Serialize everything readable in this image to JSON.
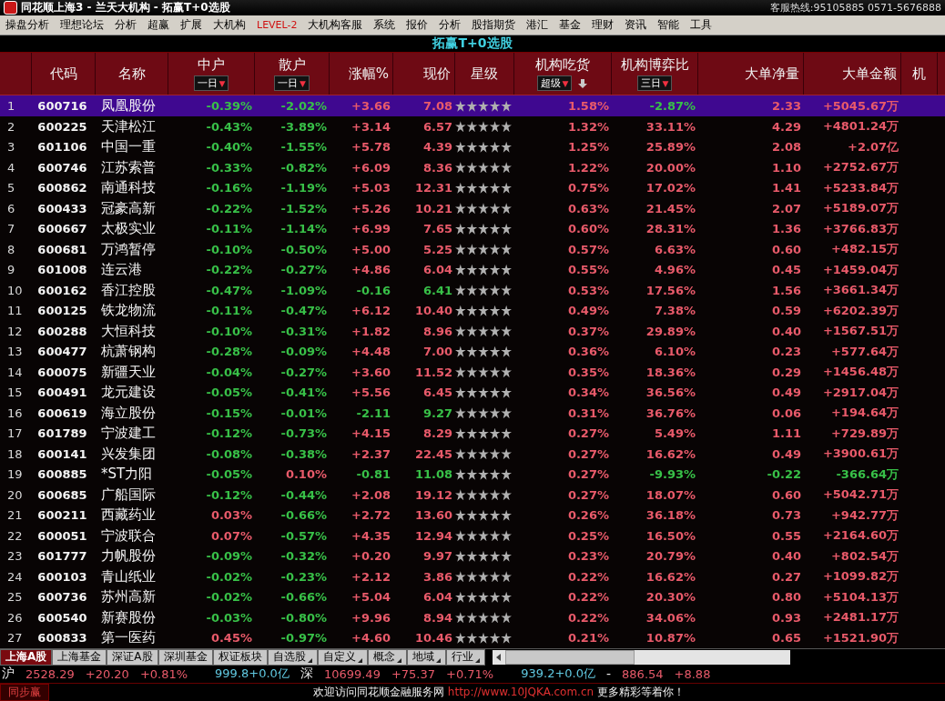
{
  "window": {
    "title": "同花顺上海3 - 兰天大机构 - 拓赢T+0选股",
    "hotline": "客服热线:95105885 0571-5676888"
  },
  "menu": [
    {
      "label": "操盘分析",
      "highlighted": false
    },
    {
      "label": "理想论坛",
      "highlighted": false
    },
    {
      "label": "分析",
      "highlighted": false
    },
    {
      "label": "超赢",
      "highlighted": false
    },
    {
      "label": "扩展",
      "highlighted": false
    },
    {
      "label": "大机构",
      "highlighted": false
    },
    {
      "label": "LEVEL-2",
      "highlighted": true
    },
    {
      "label": "大机构客服",
      "highlighted": false
    },
    {
      "label": "系统",
      "highlighted": false
    },
    {
      "label": "报价",
      "highlighted": false
    },
    {
      "label": "分析",
      "highlighted": false
    },
    {
      "label": "股指期货",
      "highlighted": false
    },
    {
      "label": "港汇",
      "highlighted": false
    },
    {
      "label": "基金",
      "highlighted": false
    },
    {
      "label": "理财",
      "highlighted": false
    },
    {
      "label": "资讯",
      "highlighted": false
    },
    {
      "label": "智能",
      "highlighted": false
    },
    {
      "label": "工具",
      "highlighted": false
    }
  ],
  "table": {
    "caption": "拓赢T+0选股",
    "columns": [
      {
        "label": "代码"
      },
      {
        "label": "名称"
      },
      {
        "label": "中户",
        "dropdown": "一日",
        "arrow": "▼"
      },
      {
        "label": "散户",
        "dropdown": "一日",
        "arrow": "▼"
      },
      {
        "label": "涨幅%"
      },
      {
        "label": "现价"
      },
      {
        "label": "星级"
      },
      {
        "label": "机构吃货",
        "dropdown": "超级",
        "arrow": "▼",
        "sort": true
      },
      {
        "label": "机构博弈比",
        "dropdown": "三日",
        "arrow": "▼"
      },
      {
        "label": "大单净量"
      },
      {
        "label": "大单金额"
      },
      {
        "label": "机"
      }
    ],
    "rows": [
      {
        "n": "1",
        "code": "600716",
        "name": "凤凰股份",
        "mid": "-0.39%",
        "retail": "-2.02%",
        "chg": "+3.66",
        "price": "7.08",
        "stars": 5,
        "inst": "1.58%",
        "ratio": "-2.87%",
        "net": "2.33",
        "amount": "+5045.67万",
        "selected": true
      },
      {
        "n": "2",
        "code": "600225",
        "name": "天津松江",
        "mid": "-0.43%",
        "retail": "-3.89%",
        "chg": "+3.14",
        "price": "6.57",
        "stars": 5,
        "inst": "1.32%",
        "ratio": "33.11%",
        "net": "4.29",
        "amount": "+4801.24万",
        "selected": false
      },
      {
        "n": "3",
        "code": "601106",
        "name": "中国一重",
        "mid": "-0.40%",
        "retail": "-1.55%",
        "chg": "+5.78",
        "price": "4.39",
        "stars": 5,
        "inst": "1.25%",
        "ratio": "25.89%",
        "net": "2.08",
        "amount": "+2.07亿",
        "selected": false
      },
      {
        "n": "4",
        "code": "600746",
        "name": "江苏索普",
        "mid": "-0.33%",
        "retail": "-0.82%",
        "chg": "+6.09",
        "price": "8.36",
        "stars": 5,
        "inst": "1.22%",
        "ratio": "20.00%",
        "net": "1.10",
        "amount": "+2752.67万",
        "selected": false
      },
      {
        "n": "5",
        "code": "600862",
        "name": "南通科技",
        "mid": "-0.16%",
        "retail": "-1.19%",
        "chg": "+5.03",
        "price": "12.31",
        "stars": 5,
        "inst": "0.75%",
        "ratio": "17.02%",
        "net": "1.41",
        "amount": "+5233.84万",
        "selected": false
      },
      {
        "n": "6",
        "code": "600433",
        "name": "冠豪高新",
        "mid": "-0.22%",
        "retail": "-1.52%",
        "chg": "+5.26",
        "price": "10.21",
        "stars": 5,
        "inst": "0.63%",
        "ratio": "21.45%",
        "net": "2.07",
        "amount": "+5189.07万",
        "selected": false
      },
      {
        "n": "7",
        "code": "600667",
        "name": "太极实业",
        "mid": "-0.11%",
        "retail": "-1.14%",
        "chg": "+6.99",
        "price": "7.65",
        "stars": 5,
        "inst": "0.60%",
        "ratio": "28.31%",
        "net": "1.36",
        "amount": "+3766.83万",
        "selected": false
      },
      {
        "n": "8",
        "code": "600681",
        "name": "万鸿暂停",
        "mid": "-0.10%",
        "retail": "-0.50%",
        "chg": "+5.00",
        "price": "5.25",
        "stars": 5,
        "inst": "0.57%",
        "ratio": "6.63%",
        "net": "0.60",
        "amount": "+482.15万",
        "selected": false
      },
      {
        "n": "9",
        "code": "601008",
        "name": "连云港",
        "mid": "-0.22%",
        "retail": "-0.27%",
        "chg": "+4.86",
        "price": "6.04",
        "stars": 5,
        "inst": "0.55%",
        "ratio": "4.96%",
        "net": "0.45",
        "amount": "+1459.04万",
        "selected": false
      },
      {
        "n": "10",
        "code": "600162",
        "name": "香江控股",
        "mid": "-0.47%",
        "retail": "-1.09%",
        "chg": "-0.16",
        "price": "6.41",
        "stars": 5,
        "inst": "0.53%",
        "ratio": "17.56%",
        "net": "1.56",
        "amount": "+3661.34万",
        "selected": false
      },
      {
        "n": "11",
        "code": "600125",
        "name": "铁龙物流",
        "mid": "-0.11%",
        "retail": "-0.47%",
        "chg": "+6.12",
        "price": "10.40",
        "stars": 5,
        "inst": "0.49%",
        "ratio": "7.38%",
        "net": "0.59",
        "amount": "+6202.39万",
        "selected": false
      },
      {
        "n": "12",
        "code": "600288",
        "name": "大恒科技",
        "mid": "-0.10%",
        "retail": "-0.31%",
        "chg": "+1.82",
        "price": "8.96",
        "stars": 5,
        "inst": "0.37%",
        "ratio": "29.89%",
        "net": "0.40",
        "amount": "+1567.51万",
        "selected": false
      },
      {
        "n": "13",
        "code": "600477",
        "name": "杭萧钢构",
        "mid": "-0.28%",
        "retail": "-0.09%",
        "chg": "+4.48",
        "price": "7.00",
        "stars": 5,
        "inst": "0.36%",
        "ratio": "6.10%",
        "net": "0.23",
        "amount": "+577.64万",
        "selected": false
      },
      {
        "n": "14",
        "code": "600075",
        "name": "新疆天业",
        "mid": "-0.04%",
        "retail": "-0.27%",
        "chg": "+3.60",
        "price": "11.52",
        "stars": 5,
        "inst": "0.35%",
        "ratio": "18.36%",
        "net": "0.29",
        "amount": "+1456.48万",
        "selected": false
      },
      {
        "n": "15",
        "code": "600491",
        "name": "龙元建设",
        "mid": "-0.05%",
        "retail": "-0.41%",
        "chg": "+5.56",
        "price": "6.45",
        "stars": 5,
        "inst": "0.34%",
        "ratio": "36.56%",
        "net": "0.49",
        "amount": "+2917.04万",
        "selected": false
      },
      {
        "n": "16",
        "code": "600619",
        "name": "海立股份",
        "mid": "-0.15%",
        "retail": "-0.01%",
        "chg": "-2.11",
        "price": "9.27",
        "stars": 5,
        "inst": "0.31%",
        "ratio": "36.76%",
        "net": "0.06",
        "amount": "+194.64万",
        "selected": false
      },
      {
        "n": "17",
        "code": "601789",
        "name": "宁波建工",
        "mid": "-0.12%",
        "retail": "-0.73%",
        "chg": "+4.15",
        "price": "8.29",
        "stars": 5,
        "inst": "0.27%",
        "ratio": "5.49%",
        "net": "1.11",
        "amount": "+729.89万",
        "selected": false
      },
      {
        "n": "18",
        "code": "600141",
        "name": "兴发集团",
        "mid": "-0.08%",
        "retail": "-0.38%",
        "chg": "+2.37",
        "price": "22.45",
        "stars": 5,
        "inst": "0.27%",
        "ratio": "16.62%",
        "net": "0.49",
        "amount": "+3900.61万",
        "selected": false
      },
      {
        "n": "19",
        "code": "600885",
        "name": "*ST力阳",
        "mid": "-0.05%",
        "retail": "0.10%",
        "chg": "-0.81",
        "price": "11.08",
        "stars": 5,
        "inst": "0.27%",
        "ratio": "-9.93%",
        "net": "-0.22",
        "amount": "-366.64万",
        "selected": false
      },
      {
        "n": "20",
        "code": "600685",
        "name": "广船国际",
        "mid": "-0.12%",
        "retail": "-0.44%",
        "chg": "+2.08",
        "price": "19.12",
        "stars": 5,
        "inst": "0.27%",
        "ratio": "18.07%",
        "net": "0.60",
        "amount": "+5042.71万",
        "selected": false
      },
      {
        "n": "21",
        "code": "600211",
        "name": "西藏药业",
        "mid": "0.03%",
        "retail": "-0.66%",
        "chg": "+2.72",
        "price": "13.60",
        "stars": 5,
        "inst": "0.26%",
        "ratio": "36.18%",
        "net": "0.73",
        "amount": "+942.77万",
        "selected": false
      },
      {
        "n": "22",
        "code": "600051",
        "name": "宁波联合",
        "mid": "0.07%",
        "retail": "-0.57%",
        "chg": "+4.35",
        "price": "12.94",
        "stars": 5,
        "inst": "0.25%",
        "ratio": "16.50%",
        "net": "0.55",
        "amount": "+2164.60万",
        "selected": false
      },
      {
        "n": "23",
        "code": "601777",
        "name": "力帆股份",
        "mid": "-0.09%",
        "retail": "-0.32%",
        "chg": "+0.20",
        "price": "9.97",
        "stars": 5,
        "inst": "0.23%",
        "ratio": "20.79%",
        "net": "0.40",
        "amount": "+802.54万",
        "selected": false
      },
      {
        "n": "24",
        "code": "600103",
        "name": "青山纸业",
        "mid": "-0.02%",
        "retail": "-0.23%",
        "chg": "+2.12",
        "price": "3.86",
        "stars": 5,
        "inst": "0.22%",
        "ratio": "16.62%",
        "net": "0.27",
        "amount": "+1099.82万",
        "selected": false
      },
      {
        "n": "25",
        "code": "600736",
        "name": "苏州高新",
        "mid": "-0.02%",
        "retail": "-0.66%",
        "chg": "+5.04",
        "price": "6.04",
        "stars": 5,
        "inst": "0.22%",
        "ratio": "20.30%",
        "net": "0.80",
        "amount": "+5104.13万",
        "selected": false
      },
      {
        "n": "26",
        "code": "600540",
        "name": "新赛股份",
        "mid": "-0.03%",
        "retail": "-0.80%",
        "chg": "+9.96",
        "price": "8.94",
        "stars": 5,
        "inst": "0.22%",
        "ratio": "34.06%",
        "net": "0.93",
        "amount": "+2481.17万",
        "selected": false
      },
      {
        "n": "27",
        "code": "600833",
        "name": "第一医药",
        "mid": "0.45%",
        "retail": "-0.97%",
        "chg": "+4.60",
        "price": "10.46",
        "stars": 5,
        "inst": "0.21%",
        "ratio": "10.87%",
        "net": "0.65",
        "amount": "+1521.90万",
        "selected": false
      }
    ]
  },
  "market_tabs": [
    {
      "label": "上海A股",
      "selected": true,
      "menu": false
    },
    {
      "label": "上海基金",
      "selected": false,
      "menu": false
    },
    {
      "label": "深证A股",
      "selected": false,
      "menu": false
    },
    {
      "label": "深圳基金",
      "selected": false,
      "menu": false
    },
    {
      "label": "权证板块",
      "selected": false,
      "menu": false
    },
    {
      "label": "自选股",
      "selected": false,
      "menu": true
    },
    {
      "label": "自定义",
      "selected": false,
      "menu": true
    },
    {
      "label": "概念",
      "selected": false,
      "menu": true
    },
    {
      "label": "地域",
      "selected": false,
      "menu": true
    },
    {
      "label": "行业",
      "selected": false,
      "menu": true
    }
  ],
  "index_bar": [
    {
      "kind": "label",
      "text": "沪"
    },
    {
      "kind": "value",
      "text": "2528.29"
    },
    {
      "kind": "value",
      "text": "+20.20"
    },
    {
      "kind": "value",
      "text": "+0.81%"
    },
    {
      "kind": "volume",
      "text": "999.8+0.0亿"
    },
    {
      "kind": "label",
      "text": "深"
    },
    {
      "kind": "value",
      "text": "10699.49"
    },
    {
      "kind": "value",
      "text": "+75.37"
    },
    {
      "kind": "value",
      "text": "+0.71%"
    },
    {
      "kind": "volume",
      "text": "939.2+0.0亿"
    },
    {
      "kind": "label",
      "text": "-"
    },
    {
      "kind": "value",
      "text": "886.54"
    },
    {
      "kind": "value",
      "text": "+8.88"
    }
  ],
  "status_bar": {
    "button": "同步赢",
    "message": "欢迎访问同花顺金融服务网",
    "link": "http://www.10JQKA.com.cn",
    "tail": "更多精彩等着你！"
  }
}
